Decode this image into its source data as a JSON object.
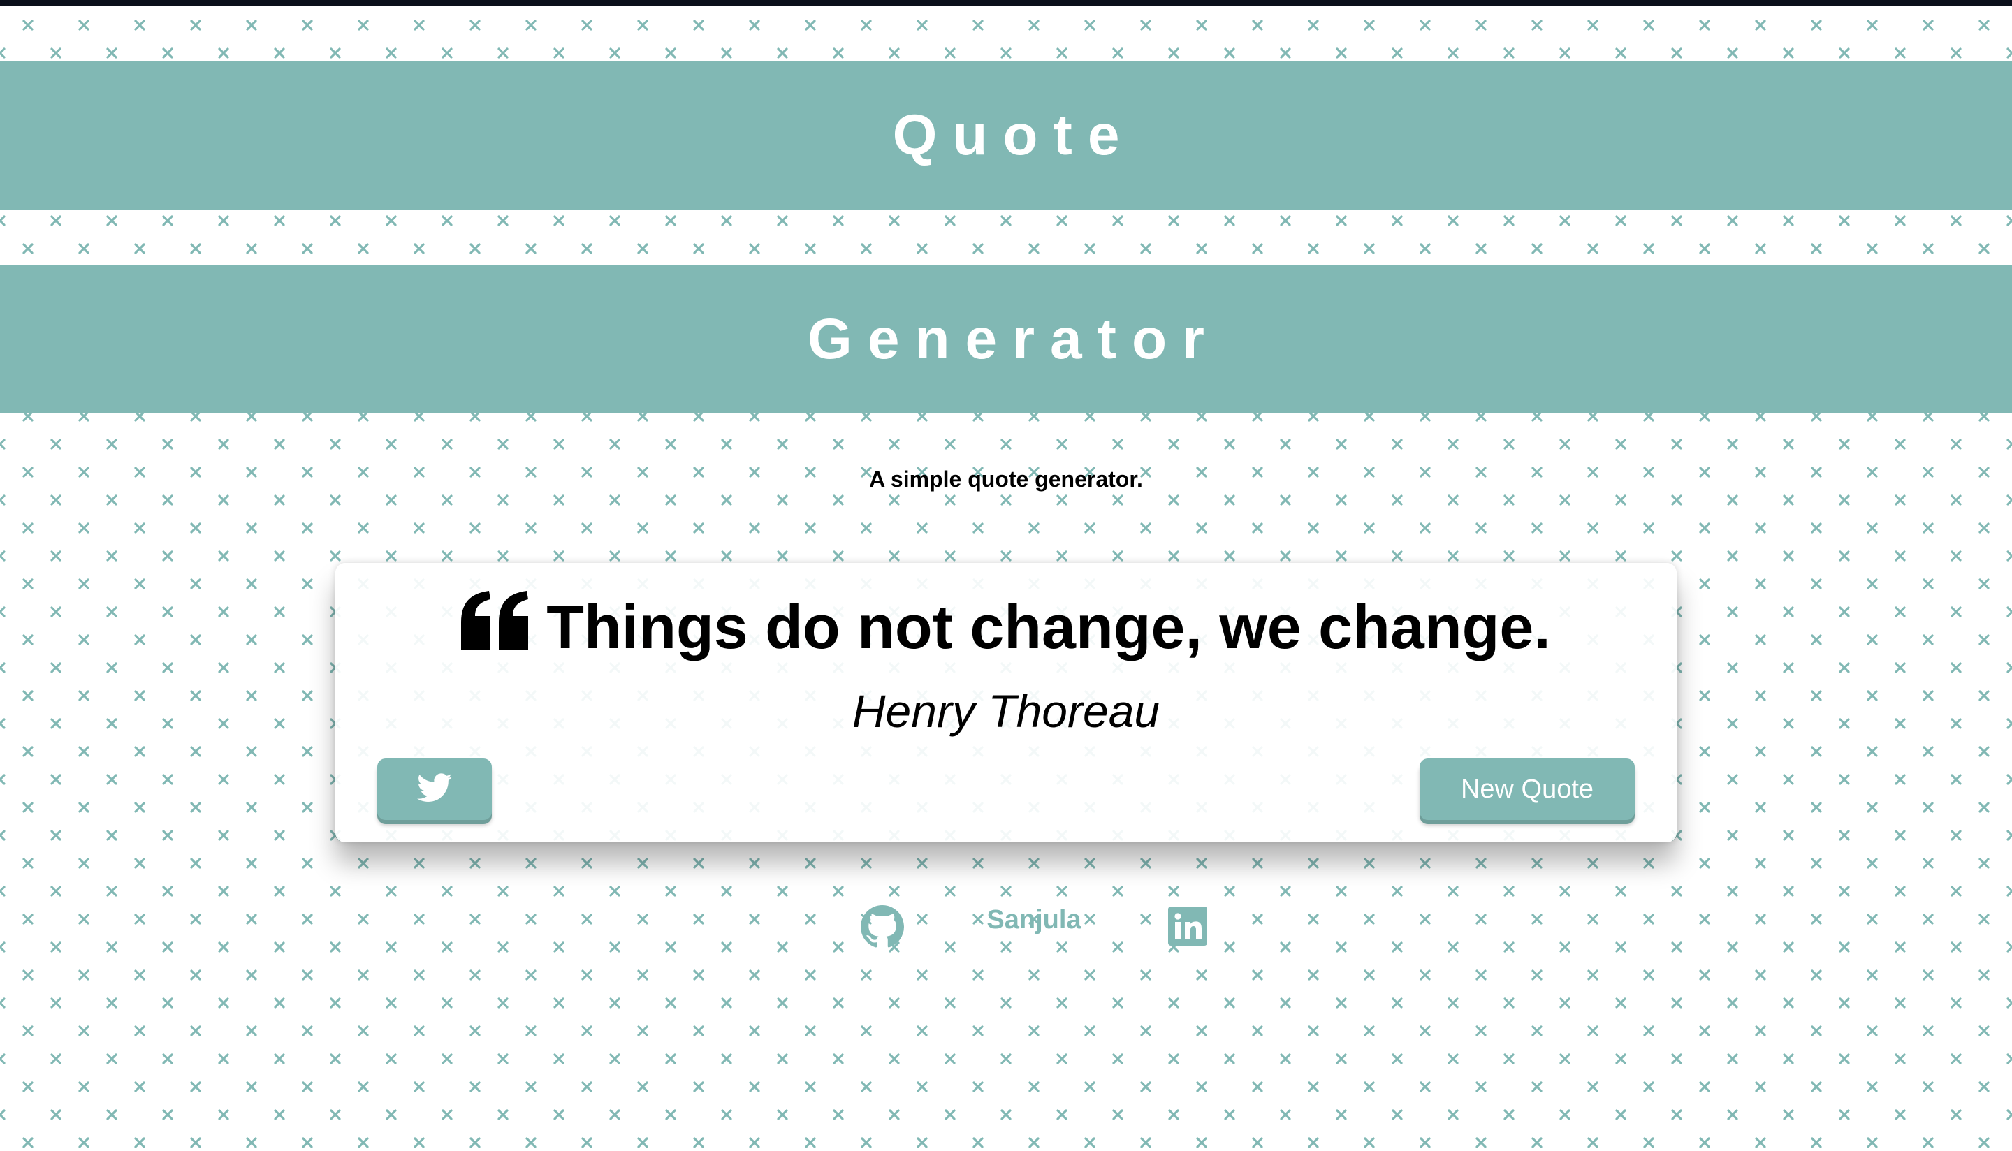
{
  "header": {
    "title_line_1": "Quote",
    "title_line_2": "Generator"
  },
  "subtitle": "A simple quote generator.",
  "quote": {
    "text": "Things do not change, we change.",
    "author": "Henry Thoreau"
  },
  "buttons": {
    "tweet_icon": "twitter-icon",
    "new_quote_label": "New Quote"
  },
  "footer": {
    "github_icon": "github-icon",
    "name": "Sanjula",
    "linkedin_icon": "linkedin-icon"
  },
  "colors": {
    "accent": "#81b8b4",
    "background": "#ffffff",
    "text": "#000000"
  }
}
